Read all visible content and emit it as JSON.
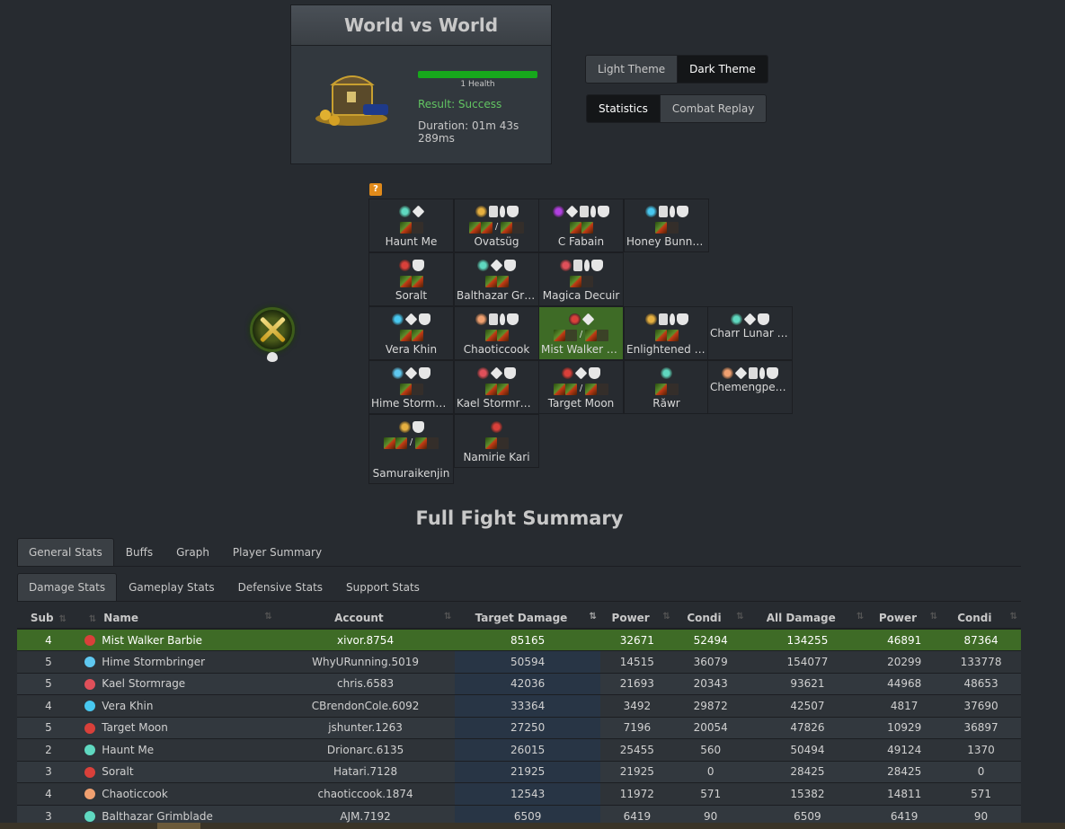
{
  "encounter": {
    "title": "World vs World",
    "health_label": "1 Health",
    "health_fraction": 1.0,
    "result": "Result: Success",
    "duration": "Duration: 01m 43s 289ms"
  },
  "theme_buttons": {
    "light": "Light Theme",
    "dark": "Dark Theme",
    "active": "dark"
  },
  "view_buttons": {
    "statistics": "Statistics",
    "replay": "Combat Replay",
    "active": "statistics"
  },
  "help_icon": "?",
  "squad": [
    {
      "name": "Haunt Me",
      "weap_sep": ""
    },
    {
      "name": "Ovatsüg",
      "weap_sep": "/"
    },
    {
      "name": "C Fabain",
      "weap_sep": ""
    },
    {
      "name": "Honey Bunny ...",
      "weap_sep": ""
    },
    {
      "name": "Soralt",
      "weap_sep": ""
    },
    {
      "name": "Balthazar Grim...",
      "weap_sep": ""
    },
    {
      "name": "Magica Decuir",
      "weap_sep": ""
    },
    {
      "name": "Vera Khin",
      "weap_sep": ""
    },
    {
      "name": "Chaoticcook",
      "weap_sep": ""
    },
    {
      "name": "Mist Walker B...",
      "weap_sep": "/"
    },
    {
      "name": "Enlightened E...",
      "weap_sep": ""
    },
    {
      "name": "Charr Lunar Cub",
      "weap_sep": ""
    },
    {
      "name": "Hime Stormbri...",
      "weap_sep": ""
    },
    {
      "name": "Kael Stormrage",
      "weap_sep": ""
    },
    {
      "name": "Target Moon",
      "weap_sep": "/"
    },
    {
      "name": "Răwr",
      "weap_sep": ""
    },
    {
      "name": "Chemengpengo",
      "weap_sep": ""
    },
    {
      "name": "Samuraikenjin",
      "weap_sep": "/"
    },
    {
      "name": "Namirie Kari",
      "weap_sep": ""
    }
  ],
  "summary": {
    "title": "Full Fight Summary",
    "main_tabs": [
      "General Stats",
      "Buffs",
      "Graph",
      "Player Summary"
    ],
    "sub_tabs": [
      "Damage Stats",
      "Gameplay Stats",
      "Defensive Stats",
      "Support Stats"
    ]
  },
  "table": {
    "headers": [
      "Sub",
      "",
      "Name",
      "Account",
      "Target Damage",
      "Power",
      "Condi",
      "All Damage",
      "Power",
      "Condi"
    ],
    "rows": [
      {
        "sub": "4",
        "color": "#d9403a",
        "name": "Mist Walker Barbie",
        "account": "xivor.8754",
        "target_damage": "85165",
        "power": "32671",
        "condi": "52494",
        "all_damage": "134255",
        "all_power": "46891",
        "all_condi": "87364"
      },
      {
        "sub": "5",
        "color": "#5fc8f0",
        "name": "Hime Stormbringer",
        "account": "WhyURunning.5019",
        "target_damage": "50594",
        "power": "14515",
        "condi": "36079",
        "all_damage": "154077",
        "all_power": "20299",
        "all_condi": "133778"
      },
      {
        "sub": "5",
        "color": "#e0505a",
        "name": "Kael Stormrage",
        "account": "chris.6583",
        "target_damage": "42036",
        "power": "21693",
        "condi": "20343",
        "all_damage": "93621",
        "all_power": "44968",
        "all_condi": "48653"
      },
      {
        "sub": "4",
        "color": "#48c8f0",
        "name": "Vera Khin",
        "account": "CBrendonCole.6092",
        "target_damage": "33364",
        "power": "3492",
        "condi": "29872",
        "all_damage": "42507",
        "all_power": "4817",
        "all_condi": "37690"
      },
      {
        "sub": "5",
        "color": "#d9403a",
        "name": "Target Moon",
        "account": "jshunter.1263",
        "target_damage": "27250",
        "power": "7196",
        "condi": "20054",
        "all_damage": "47826",
        "all_power": "10929",
        "all_condi": "36897"
      },
      {
        "sub": "2",
        "color": "#5fd8c0",
        "name": "Haunt Me",
        "account": "Drionarc.6135",
        "target_damage": "26015",
        "power": "25455",
        "condi": "560",
        "all_damage": "50494",
        "all_power": "49124",
        "all_condi": "1370"
      },
      {
        "sub": "3",
        "color": "#d9403a",
        "name": "Soralt",
        "account": "Hatari.7128",
        "target_damage": "21925",
        "power": "21925",
        "condi": "0",
        "all_damage": "28425",
        "all_power": "28425",
        "all_condi": "0"
      },
      {
        "sub": "4",
        "color": "#f0a070",
        "name": "Chaoticcook",
        "account": "chaoticcook.1874",
        "target_damage": "12543",
        "power": "11972",
        "condi": "571",
        "all_damage": "15382",
        "all_power": "14811",
        "all_condi": "571"
      },
      {
        "sub": "3",
        "color": "#5fd8c0",
        "name": "Balthazar Grimblade",
        "account": "AJM.7192",
        "target_damage": "6509",
        "power": "6419",
        "condi": "90",
        "all_damage": "6509",
        "all_power": "6419",
        "all_condi": "90"
      }
    ]
  }
}
